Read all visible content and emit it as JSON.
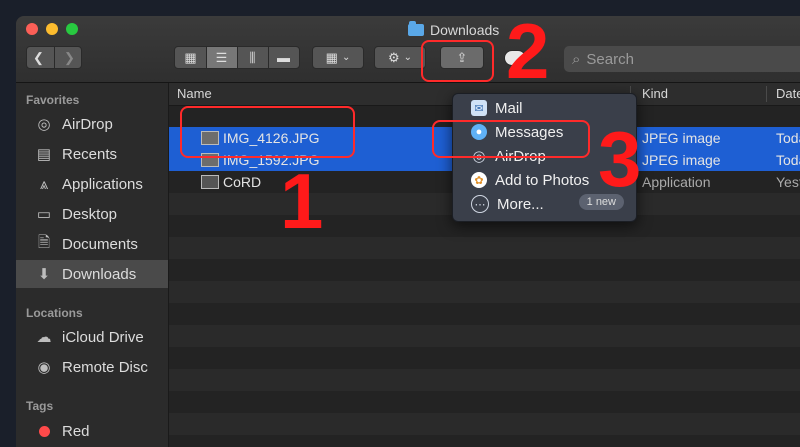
{
  "window": {
    "title": "Downloads"
  },
  "toolbar": {
    "back_icon": "chevron-left-icon",
    "forward_icon": "chevron-right-icon",
    "search_placeholder": "Search"
  },
  "sidebar": {
    "favorites_title": "Favorites",
    "favorites": [
      {
        "label": "AirDrop",
        "icon": "airdrop-icon"
      },
      {
        "label": "Recents",
        "icon": "recents-icon"
      },
      {
        "label": "Applications",
        "icon": "applications-icon"
      },
      {
        "label": "Desktop",
        "icon": "desktop-icon"
      },
      {
        "label": "Documents",
        "icon": "documents-icon"
      },
      {
        "label": "Downloads",
        "icon": "downloads-icon",
        "active": true
      }
    ],
    "locations_title": "Locations",
    "locations": [
      {
        "label": "iCloud Drive",
        "icon": "cloud-icon"
      },
      {
        "label": "Remote Disc",
        "icon": "disc-icon"
      }
    ],
    "tags_title": "Tags",
    "tags": [
      {
        "label": "Red",
        "color": "#ff4a4a"
      }
    ]
  },
  "list": {
    "columns": {
      "name": "Name",
      "kind": "Kind",
      "date": "Date"
    },
    "rows": [
      {
        "name": "IMG_4126.JPG",
        "kind": "JPEG image",
        "date": "Toda",
        "selected": true
      },
      {
        "name": "IMG_1592.JPG",
        "kind": "JPEG image",
        "date": "Toda",
        "selected": true
      },
      {
        "name": "CoRD",
        "kind": "Application",
        "date": "Yest",
        "selected": false
      }
    ]
  },
  "share_menu": {
    "items": [
      {
        "label": "Mail",
        "icon": "mail-icon"
      },
      {
        "label": "Messages",
        "icon": "messages-icon"
      },
      {
        "label": "AirDrop",
        "icon": "airdrop-icon"
      },
      {
        "label": "Add to Photos",
        "icon": "photos-icon"
      },
      {
        "label": "More...",
        "icon": "more-icon",
        "badge": "1 new"
      }
    ]
  },
  "annotations": {
    "step1": "1",
    "step2": "2",
    "step3": "3"
  },
  "colors": {
    "selection": "#1e5fd3",
    "annotation": "#ff1a1a"
  }
}
